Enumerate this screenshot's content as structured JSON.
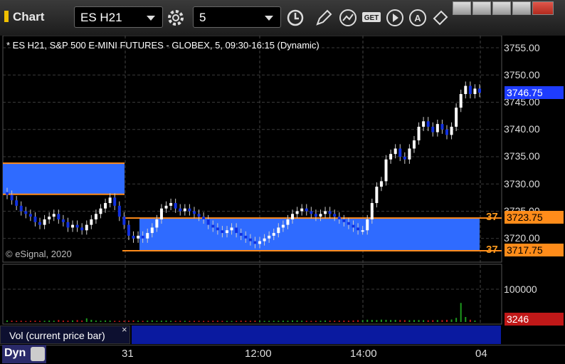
{
  "app": {
    "title": "Chart"
  },
  "toolbar": {
    "symbol": "ES H21",
    "interval": "5",
    "buttons": [
      "gear-icon",
      "clock-icon",
      "pencil-icon",
      "line-chart-icon",
      "get-icon",
      "play-icon",
      "text-icon",
      "tag-icon"
    ]
  },
  "chart_header": {
    "text": "* ES H21, S&P 500 E-MINI FUTURES - GLOBEX, 5, 09:30-16:15 (Dynamic)"
  },
  "copyright": "© eSignal, 2020",
  "price_axis": {
    "ticks": [
      "3755.00",
      "3750.00",
      "3745.00",
      "3740.00",
      "3735.00",
      "3730.00",
      "3725.00",
      "3720.00"
    ],
    "current_price": "3746.75",
    "level_high": "3723.75",
    "level_low": "3717.75",
    "side_high": "37",
    "side_low": "37"
  },
  "volume": {
    "label": "Vol (current price bar)",
    "close_glyph": "×",
    "tick": "100000",
    "current": "3246"
  },
  "time_axis": {
    "ticks": [
      "31",
      "12:00",
      "14:00",
      "04"
    ]
  },
  "dyn": {
    "label": "Dyn"
  },
  "colors": {
    "zone": "#2f6bff",
    "zone_border": "#ff8c1a",
    "up": "#ffffff",
    "down": "#1030e0",
    "vol_up": "#1e9a1e",
    "vol_down": "#c01818"
  },
  "chart_data": {
    "type": "candlestick",
    "x_labels": [
      "31",
      "12:00",
      "14:00",
      "04"
    ],
    "ylim": [
      3716,
      3757
    ],
    "zones": [
      {
        "top": 3733.8,
        "bottom": 3728.1
      },
      {
        "top": 3723.75,
        "bottom": 3717.75
      }
    ],
    "closes": [
      3728.0,
      3727.0,
      3726.0,
      3725.0,
      3724.5,
      3724.0,
      3723.0,
      3722.5,
      3723.5,
      3724.0,
      3724.5,
      3723.5,
      3723.0,
      3722.0,
      3722.5,
      3722.0,
      3721.5,
      3722.5,
      3723.5,
      3724.5,
      3725.5,
      3726.5,
      3727.5,
      3726.0,
      3724.0,
      3722.5,
      3720.5,
      3720.0,
      3720.5,
      3720.0,
      3721.0,
      3722.0,
      3723.5,
      3725.5,
      3726.0,
      3726.5,
      3725.5,
      3725.0,
      3725.5,
      3725.0,
      3724.5,
      3724.0,
      3723.5,
      3722.5,
      3722.0,
      3721.5,
      3721.0,
      3721.5,
      3722.0,
      3721.0,
      3720.5,
      3720.0,
      3719.5,
      3719.0,
      3719.5,
      3720.0,
      3720.5,
      3721.0,
      3722.0,
      3722.5,
      3723.5,
      3724.5,
      3725.0,
      3725.5,
      3725.0,
      3724.5,
      3724.0,
      3724.5,
      3725.0,
      3724.5,
      3724.0,
      3723.5,
      3723.0,
      3722.5,
      3722.0,
      3721.5,
      3721.5,
      3723.5,
      3726.5,
      3729.5,
      3730.5,
      3734.5,
      3735.5,
      3736.5,
      3735.0,
      3734.5,
      3736.5,
      3738.0,
      3740.5,
      3741.5,
      3740.5,
      3739.5,
      3741.0,
      3740.0,
      3739.0,
      3740.5,
      3744.0,
      3746.5,
      3748.0,
      3746.5,
      3747.5,
      3746.75
    ],
    "volumes": [
      3500,
      3000,
      2500,
      2800,
      2200,
      2600,
      3000,
      2400,
      2600,
      3200,
      2800,
      4500,
      3200,
      3000,
      3500,
      4200,
      3300,
      8000,
      4800,
      3200,
      2800,
      3400,
      3100,
      2600,
      2500,
      2800,
      3000,
      3400,
      2900,
      2600,
      3100,
      3600,
      2700,
      2900,
      3200,
      2600,
      2500,
      2700,
      2600,
      2500,
      2600,
      2700,
      2400,
      2500,
      2800,
      2900,
      2600,
      2400,
      2300,
      2500,
      3000,
      2700,
      2600,
      3100,
      2800,
      2400,
      2500,
      2600,
      2700,
      2900,
      2800,
      3400,
      3300,
      2900,
      2600,
      2500,
      2700,
      2800,
      3300,
      3000,
      2800,
      3100,
      3200,
      3000,
      3400,
      4100,
      3900,
      5000,
      4600,
      4200,
      5200,
      4800,
      4400,
      4600,
      4300,
      4100,
      3900,
      4200,
      4300,
      4000,
      3800,
      4100,
      4300,
      4200,
      4800,
      5500,
      9000,
      42000,
      11000,
      5000,
      3246
    ]
  }
}
